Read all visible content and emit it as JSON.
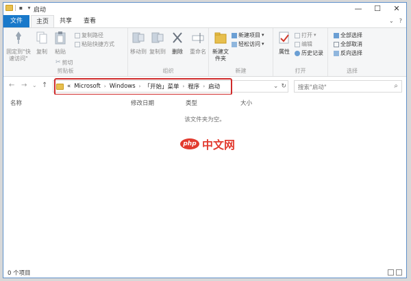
{
  "window": {
    "title": "启动",
    "minimize": "—",
    "maximize": "☐",
    "close": "✕"
  },
  "tabs": {
    "file": "文件",
    "home": "主页",
    "share": "共享",
    "view": "查看",
    "expand": "⌄",
    "help": "?"
  },
  "ribbon": {
    "clipboard": {
      "label": "剪贴板",
      "pin": "固定到\"快速访问\"",
      "copy": "复制",
      "paste": "粘贴",
      "copy_path": "复制路径",
      "paste_shortcut": "粘贴快捷方式",
      "cut": "剪切"
    },
    "organize": {
      "label": "组织",
      "move_to": "移动到",
      "copy_to": "复制到",
      "delete": "删除",
      "rename": "重命名"
    },
    "new": {
      "label": "新建",
      "new_folder": "新建文件夹",
      "new_item": "新建项目",
      "easy_access": "轻松访问"
    },
    "open": {
      "label": "打开",
      "properties": "属性",
      "open": "打开",
      "edit": "编辑",
      "history": "历史记录"
    },
    "select": {
      "label": "选择",
      "select_all": "全部选择",
      "select_none": "全部取消",
      "invert": "反向选择"
    }
  },
  "nav": {
    "back": "←",
    "forward": "→",
    "recent": "⌄",
    "up": "↑",
    "breadcrumb": [
      "«",
      "Microsoft",
      "Windows",
      "「开始」菜单",
      "程序",
      "启动"
    ],
    "dropdown": "⌄",
    "refresh": "↻",
    "search_placeholder": "搜索\"启动\"",
    "search_icon": "⌕"
  },
  "columns": {
    "name": "名称",
    "modified": "修改日期",
    "type": "类型",
    "size": "大小"
  },
  "content": {
    "empty_message": "该文件夹为空。",
    "watermark_logo": "php",
    "watermark_text": "中文网"
  },
  "status": {
    "item_count": "0 个项目"
  },
  "colors": {
    "accent": "#1979ca",
    "highlight": "#cf2a2a"
  }
}
